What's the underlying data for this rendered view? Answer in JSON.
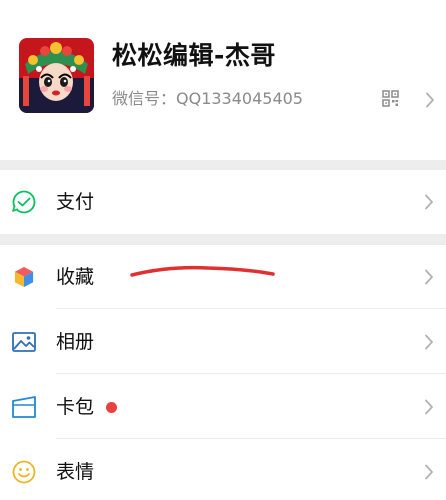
{
  "profile": {
    "nickname": "松松编辑-杰哥",
    "wechat_id": "微信号：QQ1334045405"
  },
  "menu": [
    {
      "label": "支付",
      "icon": "wechat-pay-icon"
    },
    {
      "label": "收藏",
      "icon": "favorites-cube-icon"
    },
    {
      "label": "相册",
      "icon": "album-image-icon"
    },
    {
      "label": "卡包",
      "icon": "card-wallet-icon",
      "badge": "red-dot"
    },
    {
      "label": "表情",
      "icon": "sticker-smile-icon"
    }
  ],
  "colors": {
    "background_gap": "#ededed",
    "pay_green": "#07c160",
    "album_blue": "#2e6fb8",
    "card_blue": "#1f8bd8",
    "sticker_yellow": "#f0b429",
    "badge_red": "#e64340",
    "annotation_red": "#e03030"
  }
}
